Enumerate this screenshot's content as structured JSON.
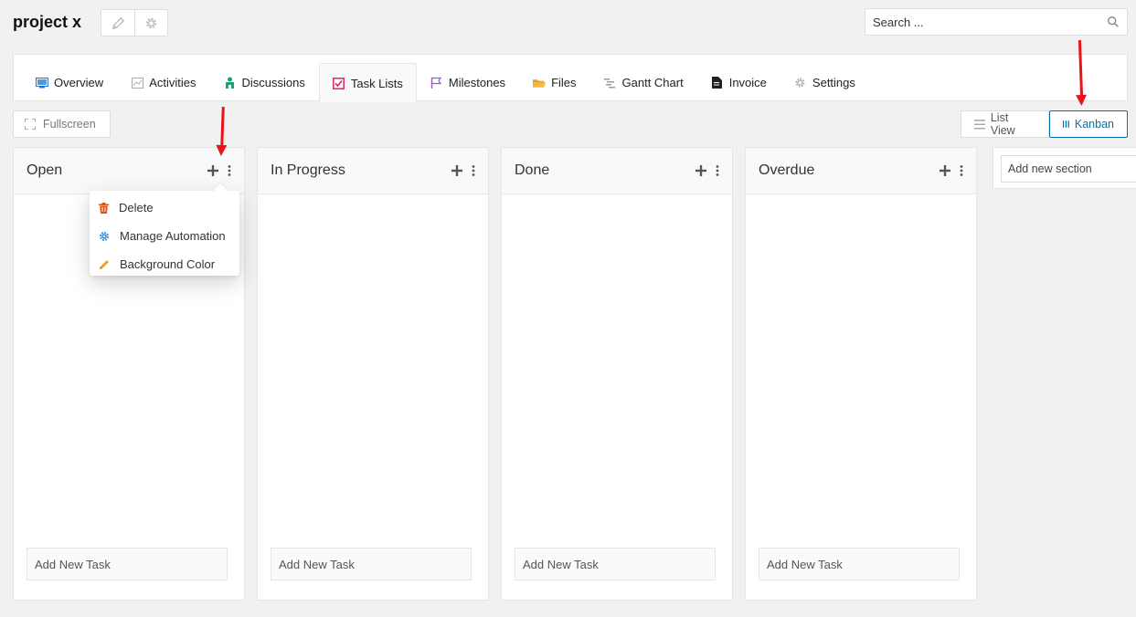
{
  "project": {
    "title": "project x",
    "edit_icon": "pencil-icon",
    "settings_icon": "gear-icon"
  },
  "search": {
    "placeholder": "Search ...",
    "icon": "search-icon"
  },
  "tabs": [
    {
      "label": "Overview",
      "icon": "monitor-icon",
      "active": false
    },
    {
      "label": "Activities",
      "icon": "chart-icon",
      "active": false
    },
    {
      "label": "Discussions",
      "icon": "users-icon",
      "active": false
    },
    {
      "label": "Task Lists",
      "icon": "checkbox-icon",
      "active": true
    },
    {
      "label": "Milestones",
      "icon": "flag-icon",
      "active": false
    },
    {
      "label": "Files",
      "icon": "folder-icon",
      "active": false
    },
    {
      "label": "Gantt Chart",
      "icon": "gantt-icon",
      "active": false
    },
    {
      "label": "Invoice",
      "icon": "document-icon",
      "active": false
    },
    {
      "label": "Settings",
      "icon": "gear-icon",
      "active": false
    }
  ],
  "toolbar": {
    "fullscreen_label": "Fullscreen",
    "list_view_label": "List View",
    "kanban_label": "Kanban",
    "active_view": "Kanban"
  },
  "columns": [
    {
      "title": "Open",
      "add_task_label": "Add New Task"
    },
    {
      "title": "In Progress",
      "add_task_label": "Add New Task"
    },
    {
      "title": "Done",
      "add_task_label": "Add New Task"
    },
    {
      "title": "Overdue",
      "add_task_label": "Add New Task"
    }
  ],
  "add_section": {
    "placeholder": "Add new section"
  },
  "column_menu": {
    "items": [
      {
        "label": "Delete",
        "icon": "trash-icon"
      },
      {
        "label": "Manage Automation",
        "icon": "gear-icon"
      },
      {
        "label": "Background Color",
        "icon": "pencil-icon"
      }
    ]
  },
  "colors": {
    "accent": "#0073aa",
    "annotation_arrow": "#e8141b",
    "background": "#f1f1f1"
  }
}
